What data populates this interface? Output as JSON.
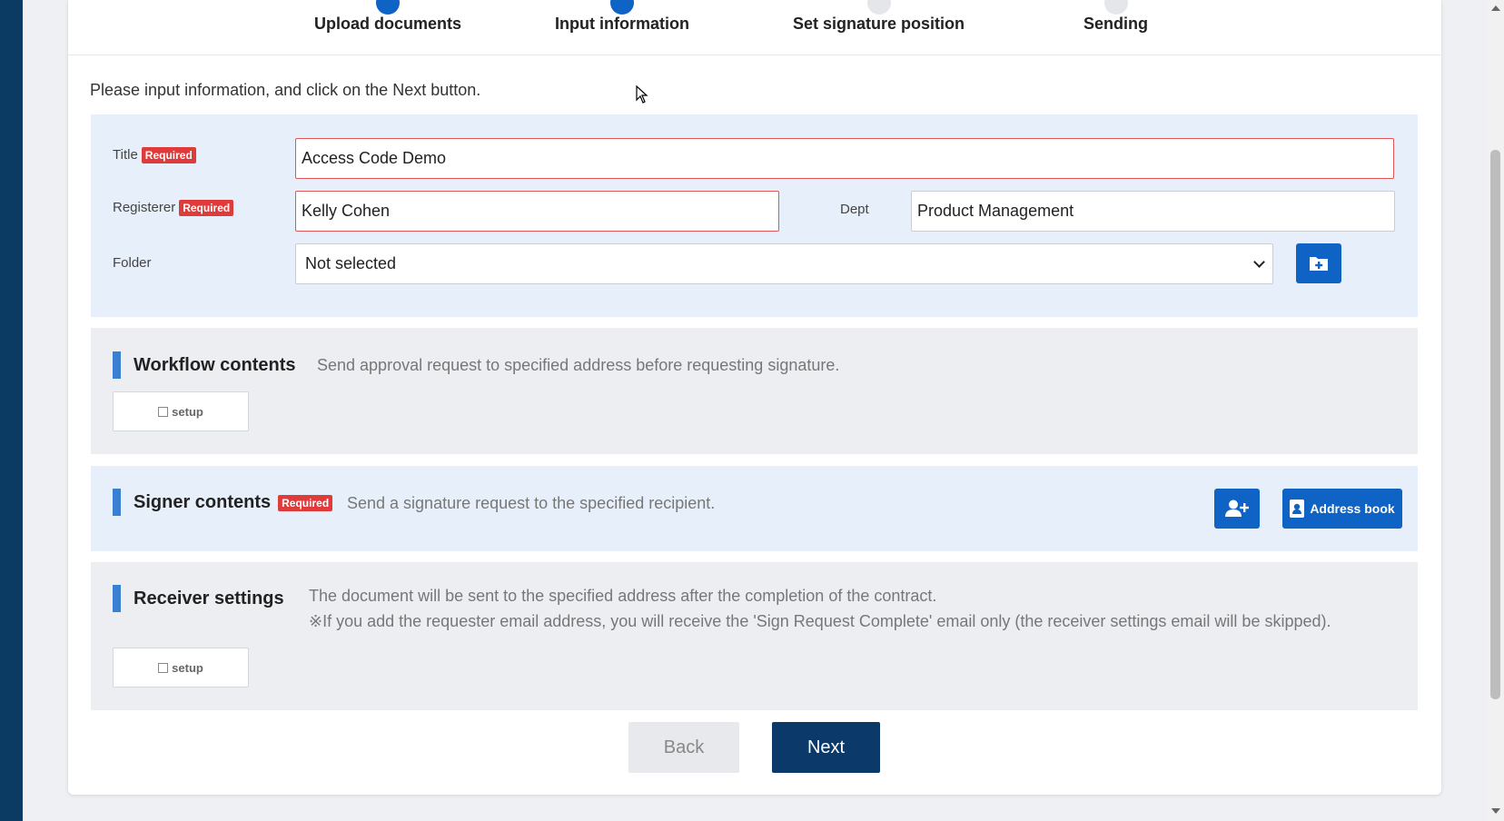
{
  "steps": [
    {
      "label": "Upload documents",
      "state": "done"
    },
    {
      "label": "Input information",
      "state": "active"
    },
    {
      "label": "Set signature position",
      "state": "pending"
    },
    {
      "label": "Sending",
      "state": "pending"
    }
  ],
  "instruction": "Please input information, and click on the Next button.",
  "required_badge": "Required",
  "form": {
    "title_label": "Title",
    "title_value": "Access Code Demo",
    "registerer_label": "Registerer",
    "registerer_value": "Kelly Cohen",
    "dept_label": "Dept",
    "dept_value": "Product Management",
    "folder_label": "Folder",
    "folder_selected": "Not selected"
  },
  "workflow": {
    "title": "Workflow contents",
    "description": "Send approval request to specified address before requesting signature.",
    "setup_label": "setup"
  },
  "signer": {
    "title": "Signer contents",
    "description": "Send a signature request to the specified recipient.",
    "address_book_label": "Address book"
  },
  "receiver": {
    "title": "Receiver settings",
    "description_line1": "The document will be sent to the specified address after the completion of the contract.",
    "description_line2": "※If you add the requester email address, you will receive the 'Sign Request Complete' email only (the receiver settings email will be skipped).",
    "setup_label": "setup"
  },
  "buttons": {
    "back_label": "Back",
    "next_label": "Next"
  },
  "colors": {
    "primary": "#0f63c4",
    "navy": "#0b3a6a",
    "required": "#e03b3b",
    "section_accent": "#3b7fd3"
  },
  "icons": {
    "folder_add": "folder-plus-icon",
    "add_user": "user-plus-icon",
    "address_book": "address-book-icon"
  }
}
